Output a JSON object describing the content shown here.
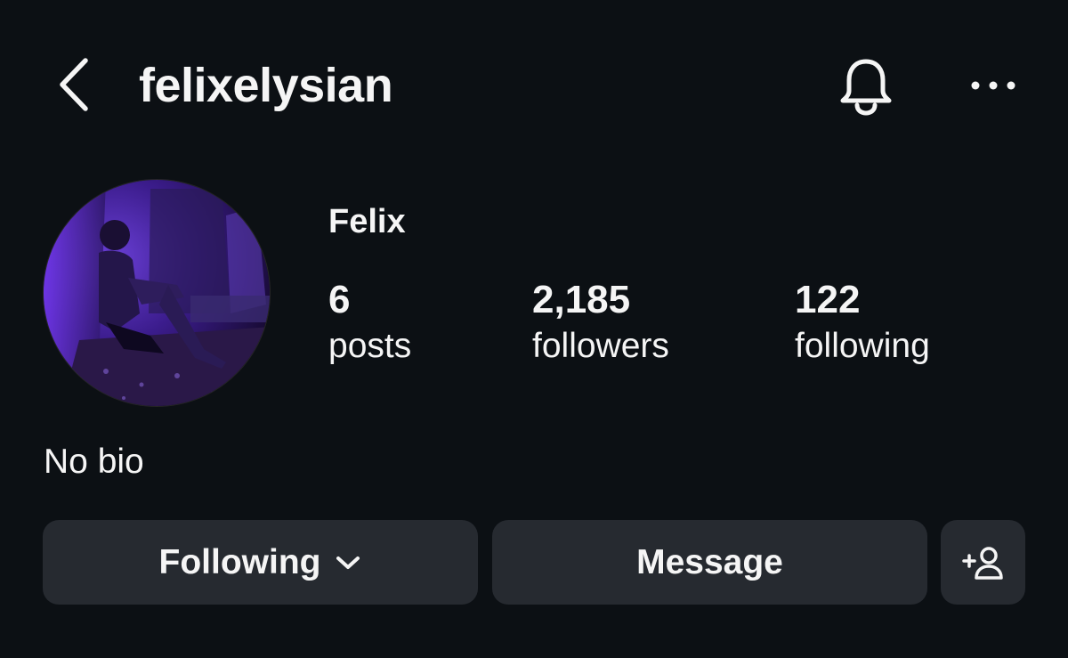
{
  "header": {
    "username": "felixelysian",
    "back_icon": "chevron-left-icon",
    "notification_icon": "bell-icon",
    "more_icon": "more-horizontal-icon"
  },
  "profile": {
    "display_name": "Felix",
    "avatar": "profile-photo",
    "bio": "No bio",
    "stats": {
      "posts": {
        "value": "6",
        "label": "posts"
      },
      "followers": {
        "value": "2,185",
        "label": "followers"
      },
      "following": {
        "value": "122",
        "label": "following"
      }
    }
  },
  "actions": {
    "following_label": "Following",
    "following_icon": "chevron-down-icon",
    "message_label": "Message",
    "suggest_icon": "add-person-icon"
  },
  "colors": {
    "background": "#0c1014",
    "button_background": "#262a30",
    "text": "#f5f5f5"
  }
}
